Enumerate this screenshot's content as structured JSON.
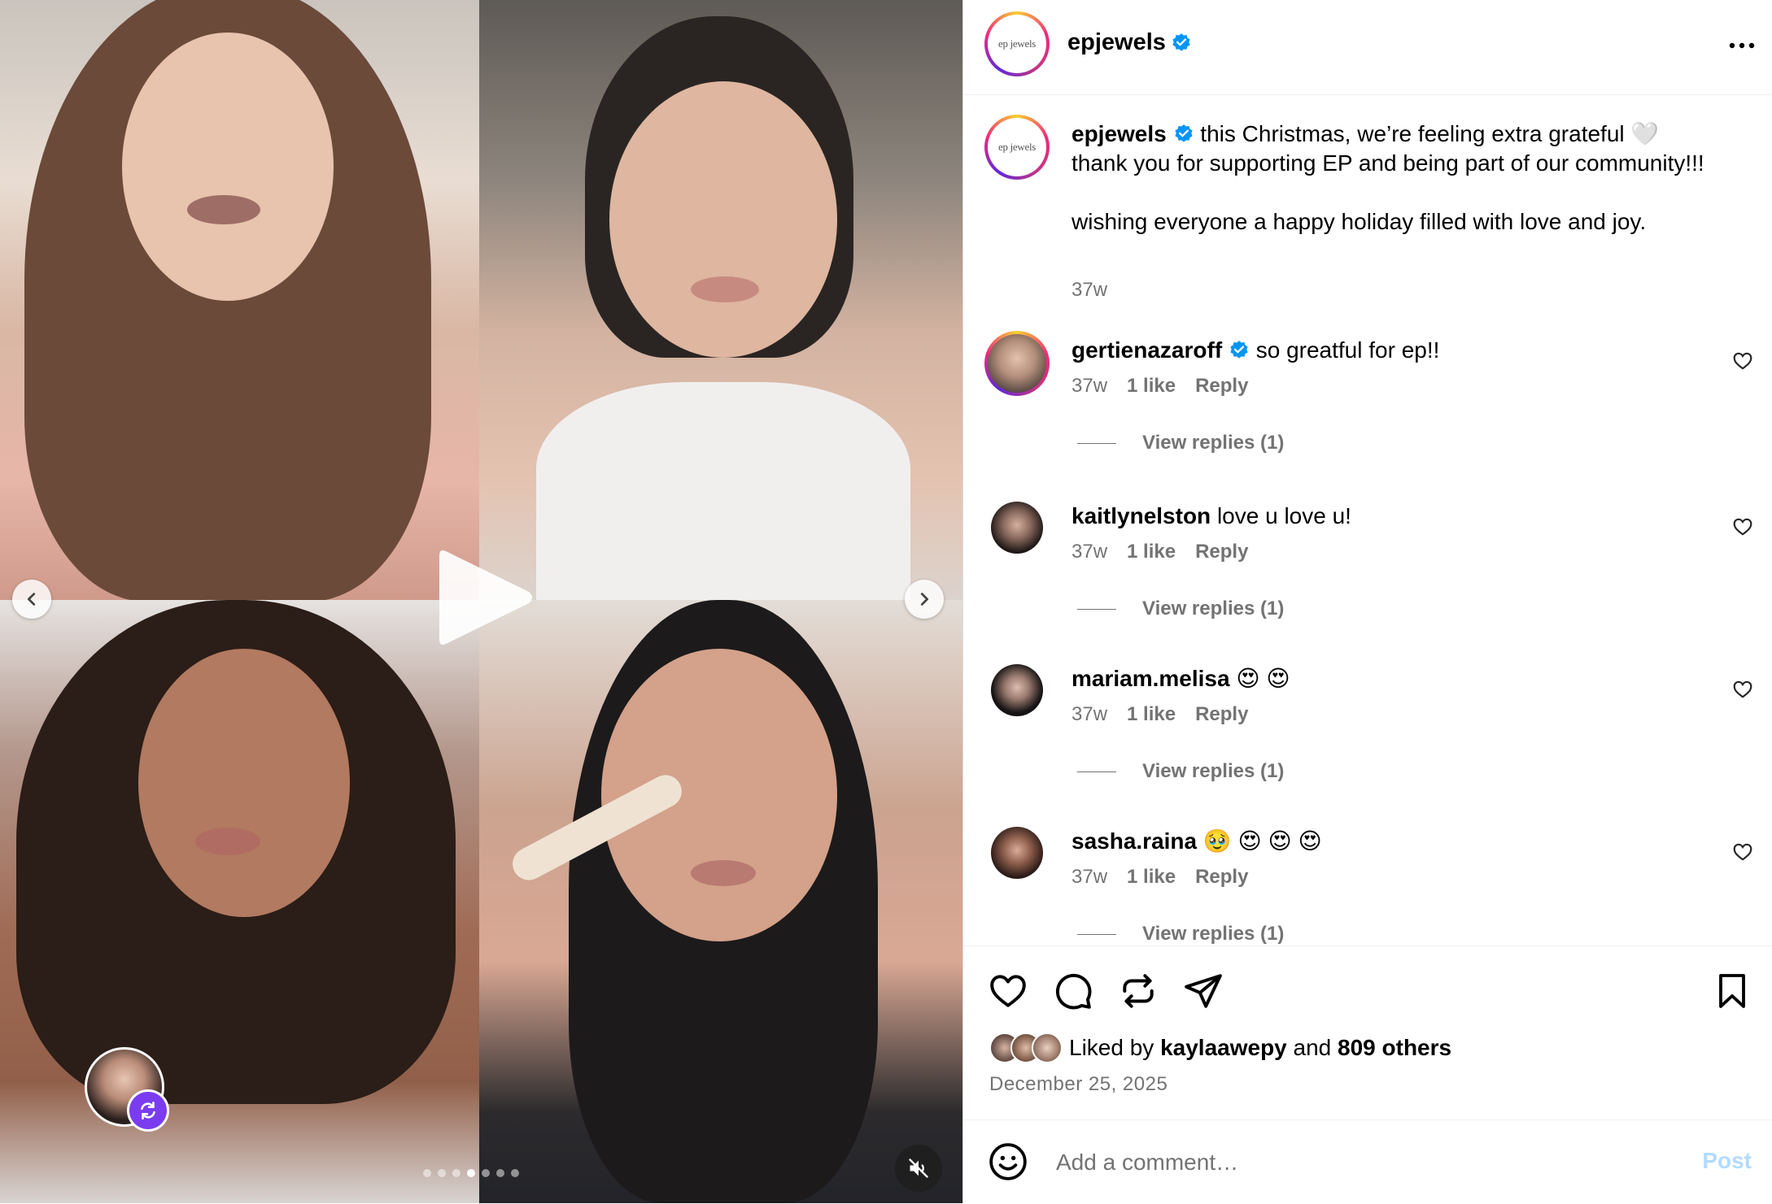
{
  "post": {
    "author": "epjewels",
    "logo_text": "ep jewels",
    "verified": true
  },
  "caption": {
    "username": "epjewels",
    "line1": "this Christmas, we’re feeling extra grateful 🤍",
    "line2": "thank you for supporting EP and being part of our community!!!",
    "line3": "wishing everyone a happy holiday filled with love and joy.",
    "time": "37w"
  },
  "comments": [
    {
      "username": "gertienazaroff",
      "verified": true,
      "text": "so greatful for ep!!",
      "time": "37w",
      "likes": "1 like",
      "reply": "Reply",
      "view_replies": "View replies (1)"
    },
    {
      "username": "kaitlynelston",
      "verified": false,
      "text": "love u love u!",
      "time": "37w",
      "likes": "1 like",
      "reply": "Reply",
      "view_replies": "View replies (1)"
    },
    {
      "username": "mariam.melisa",
      "verified": false,
      "text": "😍 😍",
      "time": "37w",
      "likes": "1 like",
      "reply": "Reply",
      "view_replies": "View replies (1)"
    },
    {
      "username": "sasha.raina",
      "verified": false,
      "text": "🥹 😍 😍 😍",
      "time": "37w",
      "likes": "1 like",
      "reply": "Reply",
      "view_replies": "View replies (1)"
    }
  ],
  "likes": {
    "prefix": "Liked by",
    "user": "kaylaawepy",
    "and": "and",
    "others": "809 others"
  },
  "date": "December 25, 2025",
  "comment_box": {
    "placeholder": "Add a comment…",
    "post_label": "Post"
  },
  "carousel": {
    "slide_count": 7,
    "active_index": 3
  },
  "colors": {
    "verified": "#0095f6",
    "muted_text": "#737373",
    "post_button": "#b3dbff",
    "collab_badge": "#7b3cf0"
  },
  "icons": [
    "chevron-left-icon",
    "chevron-right-icon",
    "play-icon",
    "mute-icon",
    "collab-icon",
    "more-icon",
    "verified-icon",
    "heart-icon",
    "comment-icon",
    "repost-icon",
    "share-icon",
    "bookmark-icon",
    "emoji-icon"
  ]
}
